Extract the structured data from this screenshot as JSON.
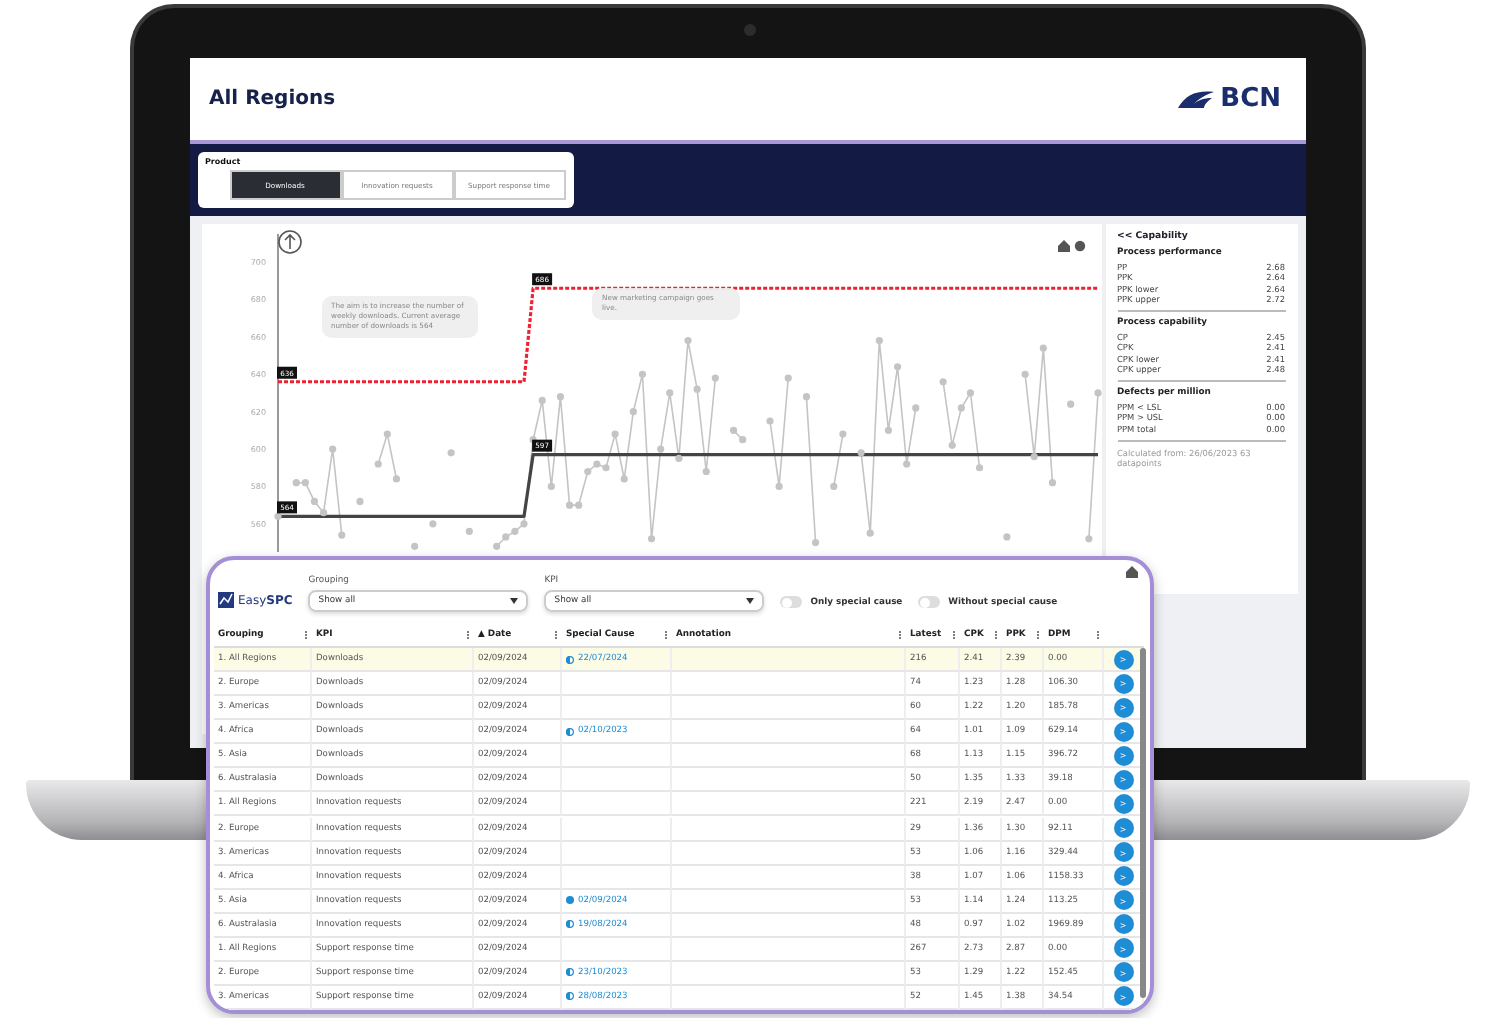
{
  "header": {
    "title": "All Regions",
    "logo": "BCN"
  },
  "product": {
    "label": "Product",
    "tabs": [
      {
        "label": "Downloads",
        "selected": true
      },
      {
        "label": "Innovation requests",
        "selected": false
      },
      {
        "label": "Support response time",
        "selected": false
      }
    ]
  },
  "chart": {
    "chart_data": {
      "type": "line",
      "ylim": [
        545,
        715
      ],
      "yticks": [
        560,
        580,
        600,
        620,
        640,
        660,
        680,
        700
      ],
      "series": [
        {
          "color": "#c4c4c4",
          "marker": "circle",
          "values": [
            564,
            null,
            582,
            582,
            572,
            566,
            600,
            554,
            null,
            572,
            null,
            592,
            608,
            584,
            null,
            548,
            null,
            560,
            null,
            598,
            null,
            556,
            null,
            null,
            548,
            553,
            556,
            560,
            605,
            626,
            580,
            628,
            570,
            570,
            588,
            592,
            590,
            608,
            584,
            620,
            640,
            552,
            600,
            630,
            595,
            658,
            632,
            588,
            638,
            null,
            610,
            605,
            null,
            null,
            615,
            580,
            638,
            null,
            628,
            550,
            null,
            580,
            608,
            null,
            598,
            555,
            658,
            610,
            644,
            592,
            622,
            null,
            null,
            636,
            602,
            622,
            630,
            590,
            null,
            null,
            553,
            null,
            640,
            596,
            654,
            582,
            null,
            624,
            null,
            552,
            630
          ]
        },
        {
          "color": "#ee2233",
          "line_style": "dashed",
          "values": [
            636,
            636,
            636,
            636,
            636,
            636,
            636,
            636,
            636,
            636,
            636,
            636,
            636,
            636,
            636,
            636,
            636,
            636,
            636,
            636,
            636,
            636,
            636,
            636,
            636,
            636,
            636,
            636,
            686,
            686,
            686,
            686,
            686,
            686,
            686,
            686,
            686,
            686,
            686,
            686,
            686,
            686,
            686,
            686,
            686,
            686,
            686,
            686,
            686,
            686,
            686,
            686,
            686,
            686,
            686,
            686,
            686,
            686,
            686,
            686,
            686,
            686,
            686,
            686,
            686,
            686,
            686,
            686,
            686,
            686,
            686,
            686,
            686,
            686,
            686,
            686,
            686,
            686,
            686,
            686,
            686,
            686,
            686,
            686,
            686,
            686,
            686,
            686,
            686,
            686,
            686
          ]
        },
        {
          "color": "#444444",
          "values": [
            564,
            564,
            564,
            564,
            564,
            564,
            564,
            564,
            564,
            564,
            564,
            564,
            564,
            564,
            564,
            564,
            564,
            564,
            564,
            564,
            564,
            564,
            564,
            564,
            564,
            564,
            564,
            564,
            597,
            597,
            597,
            597,
            597,
            597,
            597,
            597,
            597,
            597,
            597,
            597,
            597,
            597,
            597,
            597,
            597,
            597,
            597,
            597,
            597,
            597,
            597,
            597,
            597,
            597,
            597,
            597,
            597,
            597,
            597,
            597,
            597,
            597,
            597,
            597,
            597,
            597,
            597,
            597,
            597,
            597,
            597,
            597,
            597,
            597,
            597,
            597,
            597,
            597,
            597,
            597,
            597,
            597,
            597,
            597,
            597,
            597,
            597,
            597,
            597,
            597,
            597
          ]
        }
      ],
      "annotations": [
        {
          "text": "636",
          "y": 636
        },
        {
          "text": "686",
          "y": 686
        },
        {
          "text": "564",
          "y": 564
        },
        {
          "text": "597",
          "y": 597
        },
        "The aim is to increase the number of weekly downloads. Current average number of downloads is 564",
        "New marketing campaign goes live."
      ]
    }
  },
  "capability": {
    "toggle": "<< Capability",
    "sections": [
      {
        "title": "Process performance",
        "rows": [
          {
            "label": "PP",
            "value": "2.68"
          },
          {
            "label": "PPK",
            "value": "2.64"
          },
          {
            "label": "PPK lower",
            "value": "2.64"
          },
          {
            "label": "PPK upper",
            "value": "2.72"
          }
        ]
      },
      {
        "title": "Process capability",
        "rows": [
          {
            "label": "CP",
            "value": "2.45"
          },
          {
            "label": "CPK",
            "value": "2.41"
          },
          {
            "label": "CPK lower",
            "value": "2.41"
          },
          {
            "label": "CPK upper",
            "value": "2.48"
          }
        ]
      },
      {
        "title": "Defects per million",
        "rows": [
          {
            "label": "PPM < LSL",
            "value": "0.00"
          },
          {
            "label": "PPM > USL",
            "value": "0.00"
          },
          {
            "label": "PPM total",
            "value": "0.00"
          }
        ]
      }
    ],
    "footer": "Calculated from: 26/06/2023 63 datapoints"
  },
  "table_panel": {
    "logo_a": "Easy",
    "logo_b": "SPC",
    "filters": [
      {
        "label": "Grouping",
        "value": "Show all"
      },
      {
        "label": "KPI",
        "value": "Show all"
      }
    ],
    "toggles": [
      {
        "label": "Only special cause",
        "on": false
      },
      {
        "label": "Without special cause",
        "on": false
      }
    ],
    "columns": [
      {
        "label": "Grouping"
      },
      {
        "label": "KPI"
      },
      {
        "label": "Date",
        "sort": "▲"
      },
      {
        "label": "Special Cause"
      },
      {
        "label": "Annotation"
      },
      {
        "label": "Latest"
      },
      {
        "label": "CPK"
      },
      {
        "label": "PPK"
      },
      {
        "label": "DPM"
      }
    ],
    "rows": [
      {
        "selected": true,
        "grouping": "1. All Regions",
        "kpi": "Downloads",
        "date": "02/09/2024",
        "special_cause": "22/07/2024",
        "cause_filled": false,
        "latest": "216",
        "cpk": "2.41",
        "ppk": "2.39",
        "dpm": "0.00",
        "action": ">"
      },
      {
        "selected": false,
        "grouping": "2. Europe",
        "kpi": "Downloads",
        "date": "02/09/2024",
        "latest": "74",
        "cpk": "1.23",
        "ppk": "1.28",
        "dpm": "106.30",
        "action": ">"
      },
      {
        "selected": false,
        "grouping": "3. Americas",
        "kpi": "Downloads",
        "date": "02/09/2024",
        "latest": "60",
        "cpk": "1.22",
        "ppk": "1.20",
        "dpm": "185.78",
        "action": ">"
      },
      {
        "selected": false,
        "grouping": "4. Africa",
        "kpi": "Downloads",
        "date": "02/09/2024",
        "special_cause": "02/10/2023",
        "cause_filled": false,
        "latest": "64",
        "cpk": "1.01",
        "ppk": "1.09",
        "dpm": "629.14",
        "action": ">"
      },
      {
        "selected": false,
        "grouping": "5. Asia",
        "kpi": "Downloads",
        "date": "02/09/2024",
        "latest": "68",
        "cpk": "1.13",
        "ppk": "1.15",
        "dpm": "396.72",
        "action": ">"
      },
      {
        "selected": false,
        "grouping": "6. Australasia",
        "kpi": "Downloads",
        "date": "02/09/2024",
        "latest": "50",
        "cpk": "1.35",
        "ppk": "1.33",
        "dpm": "39.18",
        "action": ">"
      },
      {
        "selected": false,
        "grouping": "1. All Regions",
        "kpi": "Innovation requests",
        "date": "02/09/2024",
        "latest": "221",
        "cpk": "2.19",
        "ppk": "2.47",
        "dpm": "0.00",
        "action": ">"
      },
      {
        "selected": false,
        "grouping": "2. Europe",
        "kpi": "Innovation requests",
        "date": "02/09/2024",
        "latest": "29",
        "cpk": "1.36",
        "ppk": "1.30",
        "dpm": "92.11",
        "action": ">"
      },
      {
        "selected": false,
        "grouping": "3. Americas",
        "kpi": "Innovation requests",
        "date": "02/09/2024",
        "latest": "53",
        "cpk": "1.06",
        "ppk": "1.16",
        "dpm": "329.44",
        "action": ">"
      },
      {
        "selected": false,
        "grouping": "4. Africa",
        "kpi": "Innovation requests",
        "date": "02/09/2024",
        "latest": "38",
        "cpk": "1.07",
        "ppk": "1.06",
        "dpm": "1158.33",
        "action": ">"
      },
      {
        "selected": false,
        "grouping": "5. Asia",
        "kpi": "Innovation requests",
        "date": "02/09/2024",
        "special_cause": "02/09/2024",
        "cause_filled": true,
        "latest": "53",
        "cpk": "1.14",
        "ppk": "1.24",
        "dpm": "113.25",
        "action": ">"
      },
      {
        "selected": false,
        "grouping": "6. Australasia",
        "kpi": "Innovation requests",
        "date": "02/09/2024",
        "special_cause": "19/08/2024",
        "cause_filled": false,
        "latest": "48",
        "cpk": "0.97",
        "ppk": "1.02",
        "dpm": "1969.89",
        "action": ">"
      },
      {
        "selected": false,
        "grouping": "1. All Regions",
        "kpi": "Support response time",
        "date": "02/09/2024",
        "latest": "267",
        "cpk": "2.73",
        "ppk": "2.87",
        "dpm": "0.00",
        "action": ">"
      },
      {
        "selected": false,
        "grouping": "2. Europe",
        "kpi": "Support response time",
        "date": "02/09/2024",
        "special_cause": "23/10/2023",
        "cause_filled": false,
        "latest": "53",
        "cpk": "1.29",
        "ppk": "1.22",
        "dpm": "152.45",
        "action": ">"
      },
      {
        "selected": false,
        "grouping": "3. Americas",
        "kpi": "Support response time",
        "date": "02/09/2024",
        "special_cause": "28/08/2023",
        "cause_filled": false,
        "latest": "52",
        "cpk": "1.45",
        "ppk": "1.38",
        "dpm": "34.54",
        "action": ">"
      }
    ]
  }
}
